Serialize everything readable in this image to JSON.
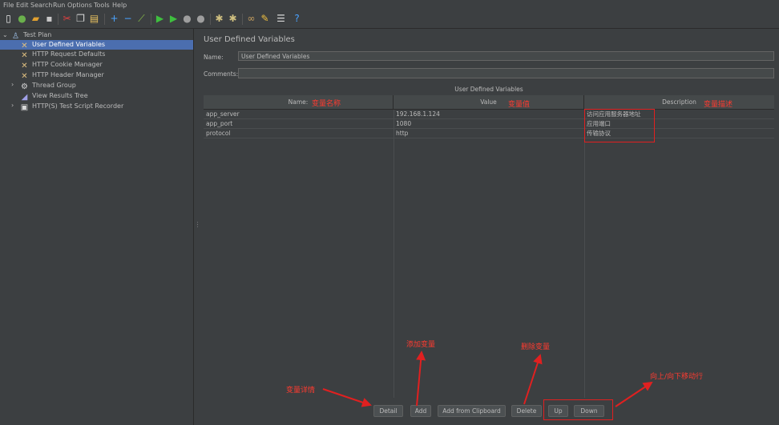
{
  "menu": [
    "File",
    "Edit",
    "Search",
    "Run",
    "Options",
    "Tools",
    "Help"
  ],
  "tree": {
    "root": "Test Plan",
    "items": [
      "User Defined Variables",
      "HTTP Request Defaults",
      "HTTP Cookie Manager",
      "HTTP Header Manager",
      "Thread Group",
      "View Results Tree",
      "HTTP(S) Test Script Recorder"
    ]
  },
  "panel": {
    "title": "User Defined Variables",
    "name_label": "Name:",
    "name_value": "User Defined Variables",
    "comments_label": "Comments:",
    "comments_value": "",
    "table_caption": "User Defined Variables"
  },
  "table": {
    "headers": [
      "Name:",
      "Value",
      "Description"
    ],
    "rows": [
      {
        "name": "app_server",
        "value": "192.168.1.124",
        "desc": "访问应用服务器地址"
      },
      {
        "name": "app_port",
        "value": "1080",
        "desc": "应用端口"
      },
      {
        "name": "protocol",
        "value": "http",
        "desc": "传输协议"
      }
    ]
  },
  "buttons": [
    "Detail",
    "Add",
    "Add from Clipboard",
    "Delete",
    "Up",
    "Down"
  ],
  "annotations": {
    "name_col": "变量名称",
    "value_col": "变量值",
    "desc_col": "变量描述",
    "detail": "变量详情",
    "add": "添加变量",
    "delete": "删除变量",
    "updown": "向上/向下移动行"
  },
  "colors": {
    "background": "#3c3f41",
    "selection": "#4b6eaf",
    "annotation": "#ff3b30",
    "text": "#bbbbbb"
  }
}
